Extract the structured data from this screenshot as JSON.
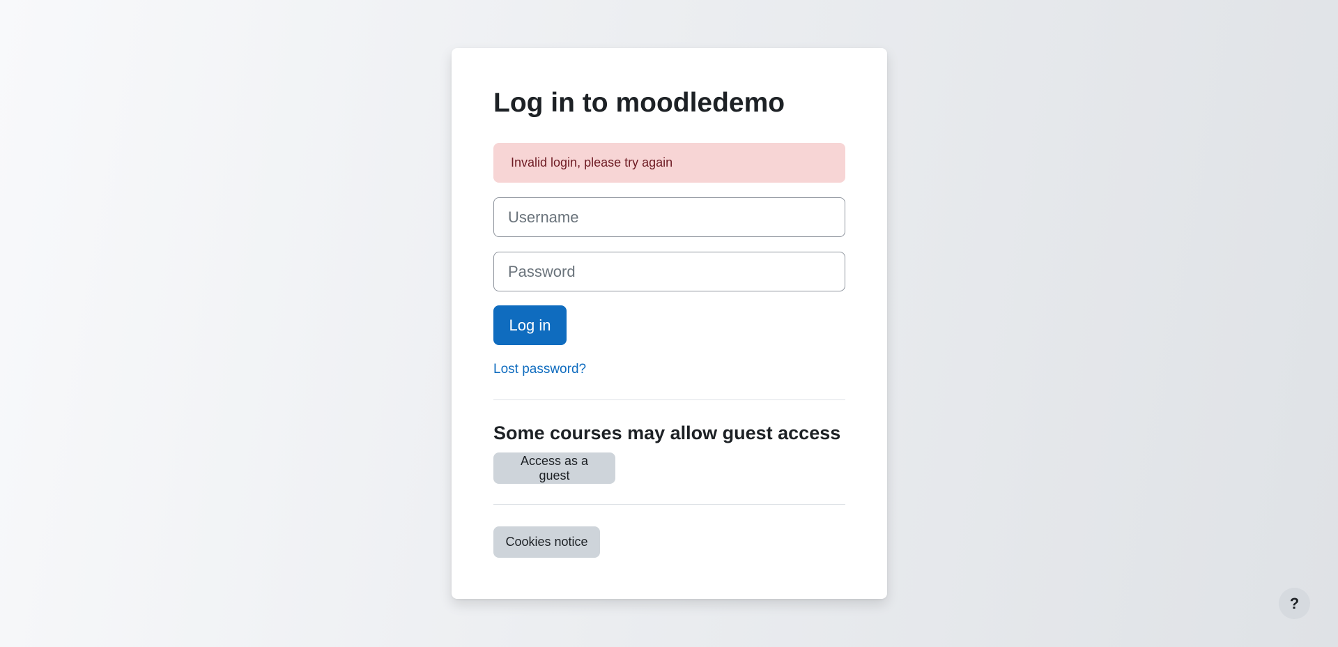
{
  "login": {
    "title": "Log in to moodledemo",
    "error_message": "Invalid login, please try again",
    "username_placeholder": "Username",
    "password_placeholder": "Password",
    "login_button": "Log in",
    "lost_password_link": "Lost password?"
  },
  "guest": {
    "heading": "Some courses may allow guest access",
    "button": "Access as a guest"
  },
  "footer": {
    "cookies_button": "Cookies notice"
  },
  "help": {
    "icon": "question-mark-icon",
    "label": "?"
  },
  "colors": {
    "primary": "#0f6cbf",
    "error_bg": "#f7d5d5",
    "error_text": "#6e1c24",
    "secondary_bg": "#ced4da"
  }
}
